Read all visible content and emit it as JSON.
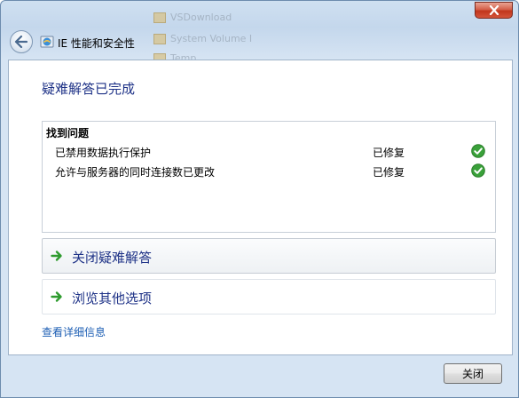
{
  "background_items": [
    "VSDownload",
    "System Volume I",
    "Temp"
  ],
  "window": {
    "title": "IE 性能和安全性",
    "heading": "疑难解答已完成"
  },
  "problems": {
    "header": "找到问题",
    "items": [
      {
        "name": "已禁用数据执行保护",
        "status": "已修复",
        "icon": "green-check-icon"
      },
      {
        "name": "允许与服务器的同时连接数已更改",
        "status": "已修复",
        "icon": "green-check-icon"
      }
    ]
  },
  "options": [
    {
      "label": "关闭疑难解答",
      "icon": "green-arrow-icon"
    },
    {
      "label": "浏览其他选项",
      "icon": "green-arrow-icon"
    }
  ],
  "details_link": "查看详细信息",
  "footer": {
    "close_label": "关闭"
  },
  "colors": {
    "heading": "#1e3287",
    "link": "#1e5fb4",
    "check": "#3aa13a",
    "close_button": "#c1361c"
  }
}
